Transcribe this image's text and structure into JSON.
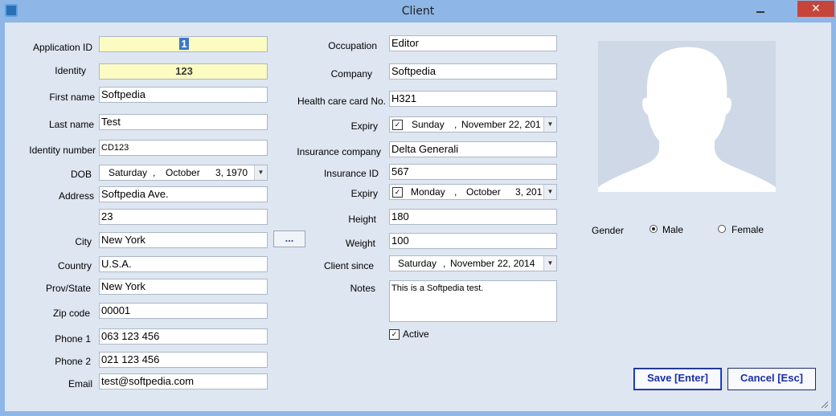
{
  "window": {
    "title": "Client",
    "close_glyph": "✕"
  },
  "left": {
    "app_id": {
      "label": "Application ID",
      "value": "1"
    },
    "identity": {
      "label": "Identity",
      "value": "123"
    },
    "first_name": {
      "label": "First name",
      "value": "Softpedia"
    },
    "last_name": {
      "label": "Last name",
      "value": "Test"
    },
    "identity_number": {
      "label": "Identity number",
      "value": "CD123"
    },
    "dob": {
      "label": "DOB",
      "day": "Saturday",
      "month": "October",
      "date": "3, 1970"
    },
    "address": {
      "label": "Address",
      "line1": "Softpedia Ave.",
      "line2": "23"
    },
    "city": {
      "label": "City",
      "value": "New York",
      "button": "..."
    },
    "country": {
      "label": "Country",
      "value": "U.S.A."
    },
    "prov": {
      "label": "Prov/State",
      "value": "New York"
    },
    "zip": {
      "label": "Zip code",
      "value": "00001"
    },
    "phone1": {
      "label": "Phone 1",
      "value": "063 123 456"
    },
    "phone2": {
      "label": "Phone 2",
      "value": "021 123 456"
    },
    "email": {
      "label": "Email",
      "value": "test@softpedia.com"
    }
  },
  "middle": {
    "occupation": {
      "label": "Occupation",
      "value": "Editor"
    },
    "company": {
      "label": "Company",
      "value": "Softpedia"
    },
    "health_card": {
      "label": "Health care card No.",
      "value": "H321"
    },
    "expiry1": {
      "label": "Expiry",
      "day": "Sunday",
      "month": "November 22, 201"
    },
    "insurance_company": {
      "label": "Insurance company",
      "value": "Delta Generali"
    },
    "insurance_id": {
      "label": "Insurance ID",
      "value": "567"
    },
    "expiry2": {
      "label": "Expiry",
      "day": "Monday",
      "month": "October",
      "date": "3, 201"
    },
    "height": {
      "label": "Height",
      "value": "180"
    },
    "weight": {
      "label": "Weight",
      "value": "100"
    },
    "client_since": {
      "label": "Client since",
      "day": "Saturday",
      "date": "November 22, 2014"
    },
    "notes": {
      "label": "Notes",
      "value": "This is a Softpedia test."
    },
    "active": {
      "label": "Active",
      "checked": true
    }
  },
  "right": {
    "gender": {
      "label": "Gender",
      "male": "Male",
      "female": "Female",
      "selected": "Male"
    }
  },
  "buttons": {
    "save": "Save [Enter]",
    "cancel": "Cancel [Esc]"
  },
  "colors": {
    "title_bar": "#8eb6e6",
    "client_bg": "#dee6f1",
    "yellow_field": "#fbfbc2",
    "close": "#c7443a",
    "button_text": "#1b2ea8"
  }
}
